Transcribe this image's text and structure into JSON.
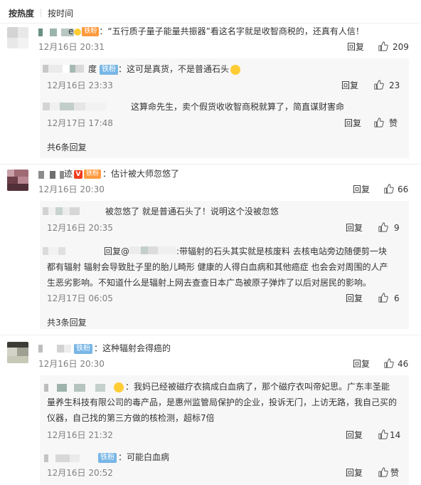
{
  "tabs": {
    "hot": "按热度",
    "time": "按时间"
  },
  "actions": {
    "reply": "回复",
    "like": "赞"
  },
  "colors": {
    "iron_badge": "#77b6e6",
    "fan_badge": "#ff9a3e",
    "muted": "#808080",
    "reply_bg": "#f7f7f7"
  },
  "comments": [
    {
      "name_tail": "e",
      "badge": "铁粉",
      "text": "：“五行质子量子能量共振器”看这名字就是收智商税的，还真有人信！",
      "time": "12月16日 20:31",
      "likes": "209",
      "replies": [
        {
          "name_tail": "度",
          "badge": "铁粉",
          "text": "：这可是真货，不是普通石头",
          "time": "12月16日 23:33",
          "likes": "23"
        },
        {
          "text": "这算命先生，卖个假货收收智商税就算了，简直谋财害命",
          "time": "12月17日 17:48",
          "likes": "赞"
        }
      ],
      "more": "共6条回复"
    },
    {
      "name_tail": "迹",
      "badge": "铁粉",
      "text": "：估计被大师忽悠了",
      "time": "12月16日 20:30",
      "likes": "66",
      "replies": [
        {
          "text": "被忽悠了 就是普通石头了！说明这个没被忽悠",
          "time": "12月16日 20:35",
          "likes": "9"
        },
        {
          "prefix": "回复@",
          "text_line1": ":带辐射的石头其实就是核废料 去核电站旁边随便剪一块",
          "text_line2": "都有辐射 辐射会导致肚子里的胎儿畸形 健康的人得白血病和其他癌症 也会会对周围的人产",
          "text_line3": "生恶劣影响。不知道什么是辐射上网去查查日本广岛被原子弹炸了以后对居民的影响。",
          "time": "12月17日 06:05",
          "likes": "6"
        }
      ],
      "more": "共3条回复"
    },
    {
      "badge": "铁粉",
      "text": "：这种辐射会得癌的",
      "time": "12月16日 20:30",
      "likes": "46",
      "replies": [
        {
          "text_line1": "：我妈已经被磁疗衣搞成白血病了，那个磁疗衣叫帝妃思。广东丰圣能",
          "text_line2": "量养生科技有限公司的毒产品，是惠州监管局保护的企业，投诉无门，上访无路，我自己买的",
          "text_line3": "仪器，自己找的第三方做的核检测，超标7倍",
          "time": "12月16日 21:32",
          "likes": "14"
        },
        {
          "badge": "铁粉",
          "text": "：可能白血病",
          "time": "12月16日 20:52",
          "likes": "赞"
        }
      ]
    }
  ]
}
